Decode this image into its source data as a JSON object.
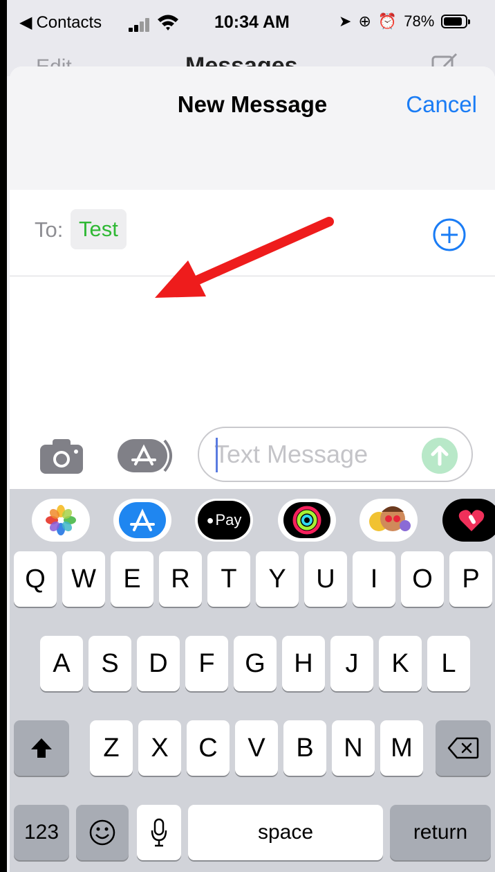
{
  "status_bar": {
    "back_label": "Contacts",
    "time": "10:34 AM",
    "battery": "78%"
  },
  "underlying": {
    "edit": "Edit",
    "title": "Messages"
  },
  "sheet": {
    "title": "New Message",
    "cancel": "Cancel"
  },
  "to_row": {
    "label": "To:",
    "recipient": "Test"
  },
  "compose": {
    "placeholder": "Text Message"
  },
  "app_strip": {
    "apple_pay": "Pay"
  },
  "keyboard": {
    "row1": [
      "Q",
      "W",
      "E",
      "R",
      "T",
      "Y",
      "U",
      "I",
      "O",
      "P"
    ],
    "row2": [
      "A",
      "S",
      "D",
      "F",
      "G",
      "H",
      "J",
      "K",
      "L"
    ],
    "row3": [
      "Z",
      "X",
      "C",
      "V",
      "B",
      "N",
      "M"
    ],
    "numbers": "123",
    "space": "space",
    "return": "return"
  },
  "colors": {
    "accent": "#1a7cf5",
    "recipient_green": "#2fb834",
    "annotation_arrow": "#ee1c1c"
  }
}
